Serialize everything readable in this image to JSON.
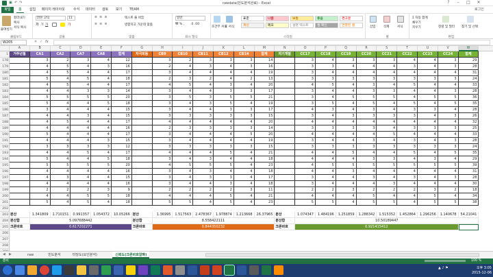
{
  "window": {
    "title": "rawdata(빈도분석완료) - Excel",
    "user": "로그인",
    "min": "–",
    "max": "□",
    "close": "✕",
    "help": "?"
  },
  "tabs": [
    "파일",
    "홈",
    "삽입",
    "페이지 레이아웃",
    "수식",
    "데이터",
    "검토",
    "보기",
    "TEAM"
  ],
  "ribbon": {
    "clipboard": {
      "label": "클립보드",
      "paste": "붙여넣기",
      "cut": "잘라내기",
      "copy": "복사",
      "format_painter": "서식 복사"
    },
    "font": {
      "label": "글꼴",
      "name": "맑은 고딕",
      "size": "11"
    },
    "align": {
      "label": "맞춤",
      "wrap": "텍스트 줄 바꿈",
      "merge": "병합하고 가운데 맞춤"
    },
    "number": {
      "label": "표시 형식",
      "format": "일반"
    },
    "styles": {
      "label": "스타일",
      "cond": "조건부 서식",
      "table": "표 서식",
      "cells": [
        {
          "text": "표준",
          "bg": "#ffffff",
          "fg": "#222222"
        },
        {
          "text": "나쁨",
          "bg": "#ffc7ce",
          "fg": "#9c0006"
        },
        {
          "text": "보통",
          "bg": "#ffeb9c",
          "fg": "#9c5700"
        },
        {
          "text": "좋음",
          "bg": "#c6efce",
          "fg": "#006100"
        },
        {
          "text": "경고문",
          "bg": "#ffffff",
          "fg": "#ff0000"
        },
        {
          "text": "계산",
          "bg": "#f2f2f2",
          "fg": "#fa7d00"
        },
        {
          "text": "메모",
          "bg": "#ffffcc",
          "fg": "#222222"
        },
        {
          "text": "설명 텍스트",
          "bg": "#ffffff",
          "fg": "#7f7f7f"
        },
        {
          "text": "셀 확인",
          "bg": "#a5a5a5",
          "fg": "#ffffff"
        },
        {
          "text": "연결된 셀",
          "bg": "#ffffff",
          "fg": "#fa7d00"
        }
      ]
    },
    "cells": {
      "label": "셀",
      "insert": "삽입",
      "delete": "삭제",
      "format": "서식"
    },
    "editing": {
      "label": "편집",
      "autosum": "자동 합계",
      "fill": "채우기",
      "clear": "지우기",
      "sort": "정렬 및 필터",
      "find": "찾기 및 선택"
    }
  },
  "namebox": "W205",
  "fx": "fx",
  "columns": [
    "A",
    "B",
    "C",
    "D",
    "E",
    "F",
    "G",
    "H",
    "I",
    "J",
    "K",
    "L",
    "M",
    "N",
    "O",
    "P",
    "Q",
    "R",
    "S",
    "T",
    "U",
    "V",
    "W"
  ],
  "header_row": {
    "num": "1",
    "cells": [
      "거주년월",
      "CA1",
      "CA2",
      "CA7",
      "CA8",
      "합계",
      "자극회동",
      "CB9",
      "CB10",
      "CB11",
      "CB12",
      "CB14",
      "합계",
      "자기개발",
      "CC17",
      "CC18",
      "CC19",
      "CC20",
      "CC21",
      "CC22",
      "CC23",
      "CC24",
      "합계"
    ]
  },
  "rows": [
    {
      "n": "178",
      "v": [
        3,
        2,
        3,
        4,
        12,
        "",
        3,
        2,
        3,
        3,
        3,
        14,
        "",
        3,
        4,
        3,
        3,
        3,
        4,
        4,
        3,
        29
      ]
    },
    {
      "n": "179",
      "v": [
        4,
        5,
        4,
        3,
        16,
        "",
        2,
        4,
        3,
        4,
        3,
        16,
        "",
        3,
        3,
        4,
        4,
        4,
        3,
        4,
        3,
        28
      ]
    },
    {
      "n": "180",
      "v": [
        4,
        5,
        4,
        4,
        17,
        "",
        3,
        4,
        4,
        4,
        4,
        19,
        "",
        3,
        4,
        4,
        4,
        4,
        4,
        4,
        4,
        31
      ]
    },
    {
      "n": "181",
      "v": [
        5,
        4,
        5,
        4,
        18,
        "",
        2,
        3,
        2,
        4,
        2,
        13,
        "",
        3,
        3,
        3,
        3,
        3,
        3,
        3,
        3,
        24
      ]
    },
    {
      "n": "182",
      "v": [
        4,
        5,
        4,
        4,
        17,
        "",
        4,
        5,
        4,
        3,
        4,
        20,
        "",
        4,
        5,
        4,
        3,
        4,
        5,
        4,
        4,
        33
      ]
    },
    {
      "n": "183",
      "v": [
        4,
        4,
        3,
        3,
        14,
        "",
        3,
        4,
        4,
        3,
        3,
        17,
        "",
        3,
        4,
        4,
        3,
        3,
        4,
        4,
        3,
        28
      ]
    },
    {
      "n": "184",
      "v": [
        5,
        5,
        5,
        5,
        20,
        "",
        3,
        5,
        3,
        5,
        5,
        21,
        "",
        3,
        4,
        5,
        5,
        5,
        4,
        5,
        5,
        36
      ]
    },
    {
      "n": "185",
      "v": [
        5,
        4,
        4,
        5,
        18,
        "",
        3,
        4,
        3,
        5,
        4,
        19,
        "",
        3,
        5,
        4,
        5,
        4,
        5,
        4,
        5,
        35
      ]
    },
    {
      "n": "186",
      "v": [
        3,
        4,
        4,
        4,
        15,
        "",
        3,
        4,
        4,
        3,
        3,
        17,
        "",
        4,
        3,
        4,
        3,
        4,
        3,
        3,
        4,
        28
      ]
    },
    {
      "n": "187",
      "v": [
        4,
        4,
        3,
        4,
        15,
        "",
        3,
        3,
        3,
        3,
        3,
        15,
        "",
        3,
        4,
        3,
        3,
        3,
        3,
        4,
        3,
        26
      ]
    },
    {
      "n": "188",
      "v": [
        4,
        5,
        4,
        4,
        17,
        "",
        4,
        4,
        4,
        4,
        4,
        20,
        "",
        4,
        4,
        4,
        4,
        4,
        4,
        4,
        4,
        32
      ]
    },
    {
      "n": "189",
      "v": [
        4,
        4,
        4,
        4,
        16,
        "",
        2,
        3,
        3,
        3,
        3,
        14,
        "",
        3,
        3,
        3,
        3,
        4,
        3,
        3,
        3,
        25
      ]
    },
    {
      "n": "190",
      "v": [
        5,
        4,
        4,
        4,
        17,
        "",
        3,
        4,
        4,
        4,
        5,
        20,
        "",
        4,
        4,
        4,
        4,
        5,
        4,
        4,
        4,
        33
      ]
    },
    {
      "n": "191",
      "v": [
        4,
        4,
        4,
        3,
        15,
        "",
        3,
        4,
        4,
        4,
        4,
        19,
        "",
        3,
        4,
        4,
        3,
        4,
        3,
        4,
        3,
        28
      ]
    },
    {
      "n": "192",
      "v": [
        3,
        3,
        3,
        3,
        12,
        "",
        3,
        3,
        3,
        3,
        3,
        15,
        "",
        3,
        3,
        3,
        3,
        3,
        3,
        3,
        3,
        24
      ]
    },
    {
      "n": "193",
      "v": [
        4,
        4,
        5,
        4,
        17,
        "",
        4,
        4,
        4,
        5,
        4,
        21,
        "",
        4,
        4,
        5,
        4,
        4,
        5,
        4,
        5,
        35
      ]
    },
    {
      "n": "194",
      "v": [
        5,
        4,
        4,
        5,
        18,
        "",
        3,
        4,
        3,
        4,
        4,
        18,
        "",
        4,
        4,
        4,
        3,
        3,
        4,
        3,
        4,
        29
      ]
    },
    {
      "n": "195",
      "v": [
        5,
        5,
        5,
        5,
        20,
        "",
        4,
        5,
        5,
        5,
        4,
        23,
        "",
        4,
        5,
        5,
        5,
        5,
        5,
        5,
        5,
        39
      ]
    },
    {
      "n": "196",
      "v": [
        4,
        4,
        4,
        4,
        16,
        "",
        3,
        4,
        3,
        4,
        4,
        18,
        "",
        4,
        4,
        3,
        4,
        4,
        4,
        4,
        4,
        31
      ]
    },
    {
      "n": "197",
      "v": [
        4,
        3,
        4,
        4,
        15,
        "",
        3,
        4,
        3,
        3,
        4,
        17,
        "",
        3,
        4,
        4,
        3,
        4,
        3,
        4,
        3,
        28
      ]
    },
    {
      "n": "198",
      "v": [
        4,
        4,
        4,
        4,
        16,
        "",
        3,
        4,
        4,
        3,
        4,
        18,
        "",
        3,
        4,
        4,
        4,
        3,
        4,
        4,
        4,
        30
      ]
    },
    {
      "n": "199",
      "v": [
        2,
        2,
        2,
        3,
        9,
        "",
        2,
        2,
        2,
        2,
        3,
        11,
        "",
        2,
        2,
        3,
        2,
        2,
        2,
        3,
        2,
        18
      ]
    },
    {
      "n": "200",
      "v": [
        4,
        4,
        5,
        5,
        18,
        "",
        4,
        4,
        4,
        5,
        4,
        21,
        "",
        4,
        4,
        4,
        5,
        4,
        4,
        5,
        4,
        34
      ]
    },
    {
      "n": "201",
      "v": [
        5,
        4,
        5,
        4,
        18,
        "",
        5,
        5,
        4,
        5,
        4,
        23,
        "",
        5,
        5,
        4,
        5,
        5,
        4,
        5,
        5,
        38
      ]
    }
  ],
  "blank_row": "202",
  "variance_row": {
    "n": "203",
    "label": "분산",
    "v": [
      "1.341809",
      "1.710151",
      "0.991357",
      "1.054372",
      "10.05266",
      "분산",
      "1.36995",
      "1.517563",
      "2.478367",
      "1.978874",
      "1.213668",
      "26.37965",
      "분산",
      "1.074347",
      "1.484196",
      "1.251859",
      "1.288342",
      "1.515352",
      "1.452864",
      "1.296256",
      "1.140678",
      "54.21041"
    ]
  },
  "sum_row": {
    "n": "204",
    "label": "분산합",
    "a": "5.097688442",
    "b_label": "분산합",
    "b": "8.558422111",
    "c_label": "분산합",
    "c": "10.50189447"
  },
  "alpha_row": {
    "n": "205",
    "label": "크론바흐",
    "a": "0.617202271",
    "b_label": "크론바흐",
    "b": "0.844350232",
    "c_label": "크론바흐",
    "c": "0.921415412"
  },
  "sheets": [
    "raw",
    "빈도분석",
    "타당도(요인분석)",
    "신뢰도(크론바흐알파)"
  ],
  "active_sheet": 3,
  "add_sheet": "+",
  "status": {
    "left": "준비",
    "zoom": "100 %"
  },
  "clock": {
    "time": "오후 3:05",
    "date": "2015-12-06"
  },
  "colors": {
    "excel_green": "#217346",
    "purple": "#5d4a87",
    "orange": "#e06b17",
    "green": "#6a9a2e",
    "hdr_purple": "#7a5ea8",
    "hdr_orange": "#f0833a",
    "hdr_green": "#77b336"
  }
}
